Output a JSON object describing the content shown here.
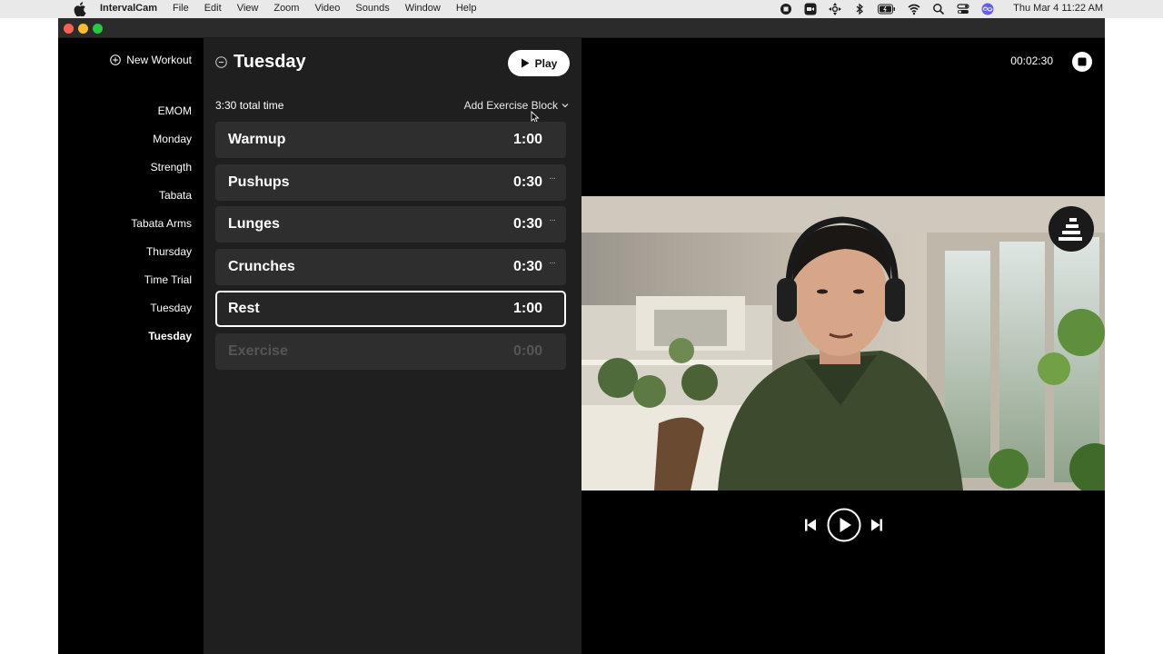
{
  "menubar": {
    "app_name": "IntervalCam",
    "menus": [
      "File",
      "Edit",
      "View",
      "Zoom",
      "Video",
      "Sounds",
      "Window",
      "Help"
    ],
    "status_icons": [
      "record-icon",
      "camera-icon",
      "move-icon",
      "bluetooth-icon",
      "battery-icon",
      "wifi-icon",
      "spotlight-icon",
      "control-center-icon",
      "siri-icon"
    ],
    "clock": "Thu Mar 4  11:22 AM"
  },
  "sidebar": {
    "new_workout_label": "New Workout",
    "workouts": [
      {
        "label": "EMOM",
        "active": false
      },
      {
        "label": "Monday",
        "active": false
      },
      {
        "label": "Strength",
        "active": false
      },
      {
        "label": "Tabata",
        "active": false
      },
      {
        "label": "Tabata Arms",
        "active": false
      },
      {
        "label": "Thursday",
        "active": false
      },
      {
        "label": "Time Trial",
        "active": false
      },
      {
        "label": "Tuesday",
        "active": false
      },
      {
        "label": "Tuesday",
        "active": true
      }
    ]
  },
  "editor": {
    "title": "Tuesday",
    "play_label": "Play",
    "total_time": "3:30 total time",
    "add_block_label": "Add Exercise Block",
    "blocks": [
      {
        "name": "Warmup",
        "time": "1:00",
        "more": false,
        "selected": false,
        "placeholder": false
      },
      {
        "name": "Pushups",
        "time": "0:30",
        "more": true,
        "selected": false,
        "placeholder": false
      },
      {
        "name": "Lunges",
        "time": "0:30",
        "more": true,
        "selected": false,
        "placeholder": false
      },
      {
        "name": "Crunches",
        "time": "0:30",
        "more": true,
        "selected": false,
        "placeholder": false
      },
      {
        "name": "Rest",
        "time": "1:00",
        "more": false,
        "selected": true,
        "placeholder": false
      },
      {
        "name": "Exercise",
        "time": "0:00",
        "more": false,
        "selected": false,
        "placeholder": true
      }
    ],
    "more_glyph": "···"
  },
  "video": {
    "timer": "00:02:30"
  },
  "colors": {
    "editor_bg": "#1f1f1f",
    "block_bg": "#2e2e2e",
    "accent_white": "#ffffff"
  }
}
